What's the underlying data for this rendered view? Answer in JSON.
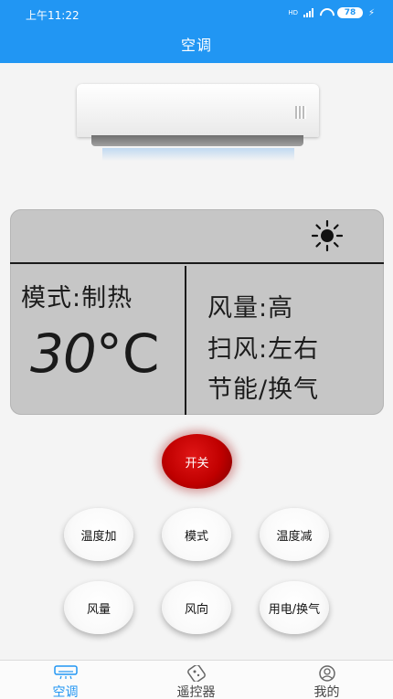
{
  "status_bar": {
    "time": "上午11:22",
    "hd": "HD",
    "battery": "78"
  },
  "header": {
    "title": "空调"
  },
  "display": {
    "mode": "模式:制热",
    "temperature": "30",
    "temperature_unit": "°C",
    "fan_speed": "风量:高",
    "swing": "扫风:左右",
    "energy": "节能/换气",
    "indicator_icon": "sun-icon"
  },
  "controls": {
    "power_label": "开关",
    "temp_up_label": "温度加",
    "mode_label": "模式",
    "temp_down_label": "温度减",
    "fan_label": "风量",
    "direction_label": "风向",
    "power_save_label": "用电/换气"
  },
  "bottom_nav": {
    "items": [
      {
        "label": "空调",
        "icon": "air-conditioner-icon",
        "active": true
      },
      {
        "label": "遥控器",
        "icon": "remote-icon",
        "active": false
      },
      {
        "label": "我的",
        "icon": "user-icon",
        "active": false
      }
    ]
  },
  "colors": {
    "primary": "#2196f3",
    "power_button": "#c00000",
    "panel_background": "#c6c6c6"
  }
}
